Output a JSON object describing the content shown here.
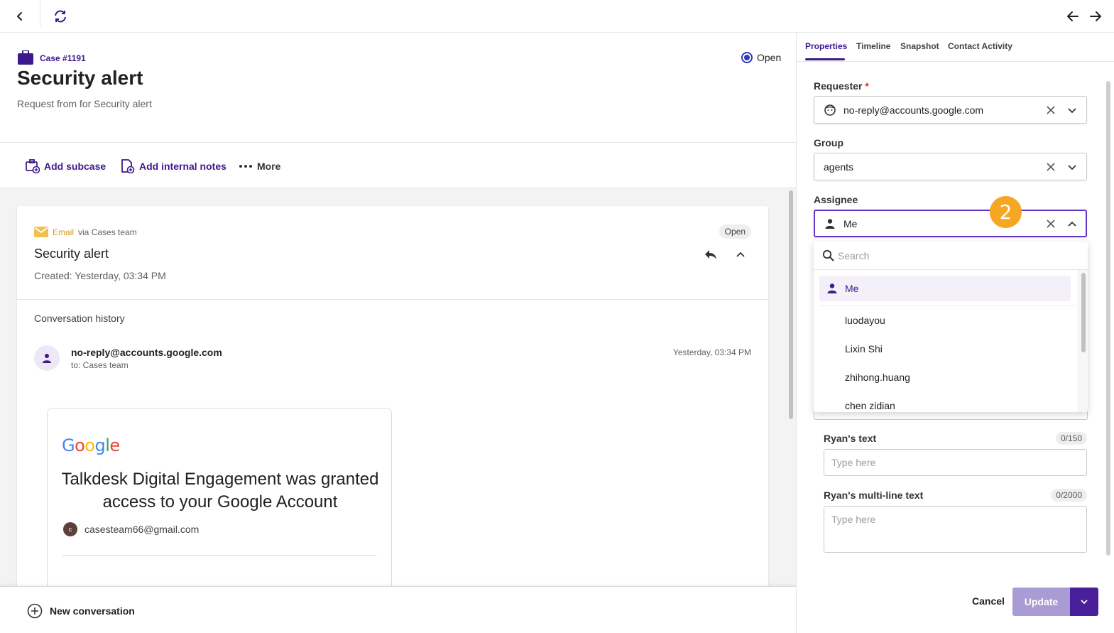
{
  "topbar": {
    "back_icon": "chevron-left-icon",
    "sync_icon": "sync-icon",
    "prev_icon": "arrow-left-icon",
    "next_icon": "arrow-right-icon"
  },
  "case": {
    "number": "Case #1191",
    "title": "Security alert",
    "subtitle": "Request from  for Security alert",
    "status": "Open"
  },
  "actions": {
    "add_subcase": "Add subcase",
    "add_internal_notes": "Add internal notes",
    "more": "More"
  },
  "conversation": {
    "channel": "Email",
    "via": "via Cases team",
    "status": "Open",
    "title": "Security alert",
    "created": "Created: Yesterday, 03:34 PM",
    "history_label": "Conversation history",
    "sender": "no-reply@accounts.google.com",
    "to": "to: Cases team",
    "time": "Yesterday, 03:34 PM",
    "email_body": {
      "message": "Talkdesk Digital Engagement was granted access to your Google Account",
      "account_initial": "c",
      "account": "casesteam66@gmail.com"
    }
  },
  "bottom": {
    "new_conversation": "New conversation"
  },
  "tabs": [
    "Properties",
    "Timeline",
    "Snapshot",
    "Contact Activity"
  ],
  "properties": {
    "requester_label": "Requester",
    "requester_required": "*",
    "requester_value": "no-reply@accounts.google.com",
    "group_label": "Group",
    "group_value": "agents",
    "assignee_label": "Assignee",
    "assignee_value": "Me",
    "step_badge": "2",
    "dropdown": {
      "search_placeholder": "Search",
      "options": [
        "Me",
        "luodayou",
        "Lixin Shi",
        "zhihong.huang",
        "chen zidian"
      ]
    },
    "ryans_text_label": "Ryan's text",
    "ryans_text_counter": "0/150",
    "ryans_text_placeholder": "Type here",
    "ryans_multiline_label": "Ryan's multi-line text",
    "ryans_multiline_counter": "0/2000",
    "ryans_multiline_placeholder": "Type here"
  },
  "footer": {
    "cancel": "Cancel",
    "update": "Update"
  },
  "colors": {
    "brand": "#3c1a8e",
    "accent": "#6235c5",
    "badge": "#f5a623",
    "update_disabled": "#a99bd4"
  }
}
